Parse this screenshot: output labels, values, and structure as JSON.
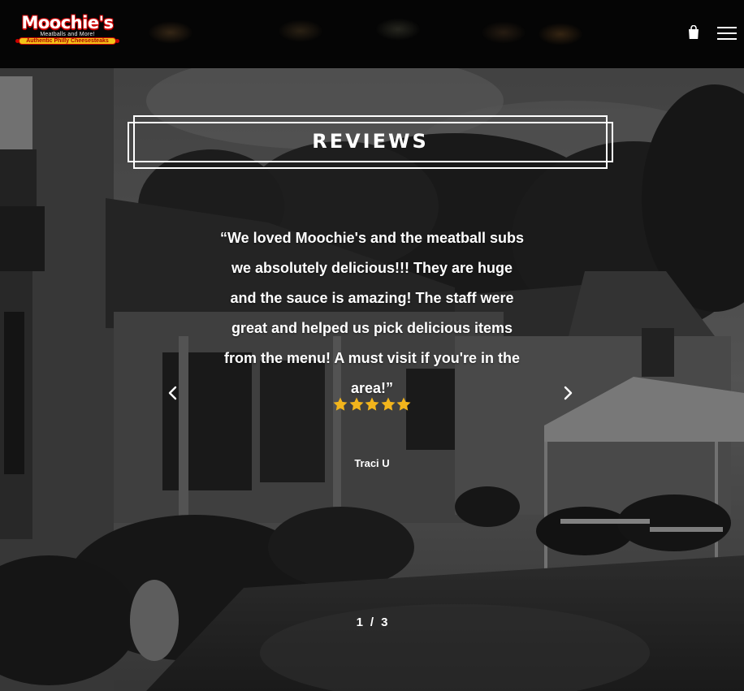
{
  "header": {
    "logo": {
      "name": "Moochie's",
      "tagline": "Meatballs and More!",
      "band": "Authentic Philly Cheesesteaks"
    },
    "icons": [
      "shopping-bag-icon",
      "hamburger-menu-icon"
    ]
  },
  "reviews": {
    "title": "REVIEWS",
    "quote": "“We loved Moochie's and the meatball subs we absolutely delicious!!! They are huge and the sauce is amazing! The staff were great and helped us pick delicious items from the menu! A must visit if you're in the area!”",
    "rating": 5,
    "rating_max": 5,
    "reviewer": "Traci U",
    "pager": {
      "current": "1",
      "separator": "/",
      "total": "3"
    }
  },
  "colors": {
    "star": "#f2b51c",
    "header_bg": "#050505",
    "text": "#ffffff"
  }
}
